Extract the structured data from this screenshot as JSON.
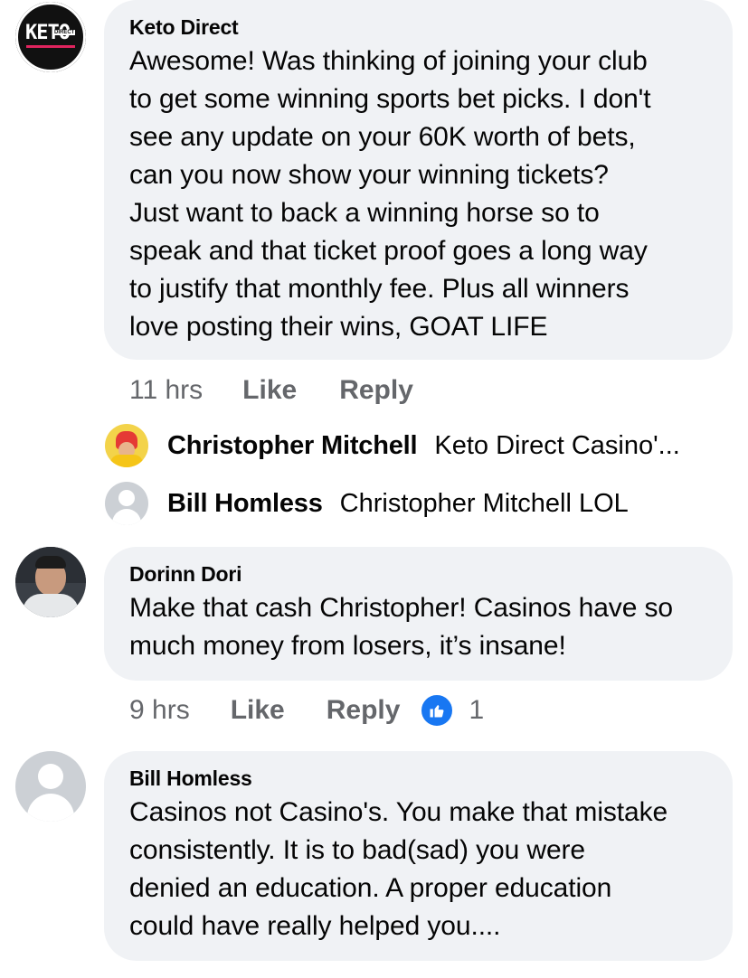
{
  "comments": [
    {
      "author": "Keto Direct",
      "text_lines": [
        "Awesome!  Was thinking of joining your club",
        "to get some winning sports bet picks.  I don't",
        "see any update on your 60K worth of bets,",
        "can you now show your winning tickets?",
        "Just want to back a winning horse so to",
        "speak and that ticket proof goes a long way",
        "to justify that monthly fee. Plus all winners",
        "love posting their wins, GOAT LIFE"
      ],
      "time": "11 hrs",
      "like_label": "Like",
      "reply_label": "Reply",
      "avatar_logo": {
        "main": "KETO",
        "sub": "DIRECT"
      }
    },
    {
      "author": "Dorinn Dori",
      "text_lines": [
        "Make that cash Christopher! Casinos have so",
        "much money from losers, it’s insane!"
      ],
      "time": "9 hrs",
      "like_label": "Like",
      "reply_label": "Reply",
      "reaction_count": "1"
    },
    {
      "author": "Bill Homless",
      "text_lines": [
        "Casinos not Casino's. You make that mistake",
        "consistently. It is to bad(sad) you were",
        "denied an education. A proper education",
        "could have really helped you...."
      ]
    }
  ],
  "replies": [
    {
      "name": "Christopher Mitchell",
      "text": "Keto Direct Casino'..."
    },
    {
      "name": "Bill Homless",
      "text": "Christopher Mitchell LOL"
    }
  ],
  "colors": {
    "bubble": "#f0f2f5",
    "meta": "#65676b",
    "like_blue": "#1877f2"
  }
}
